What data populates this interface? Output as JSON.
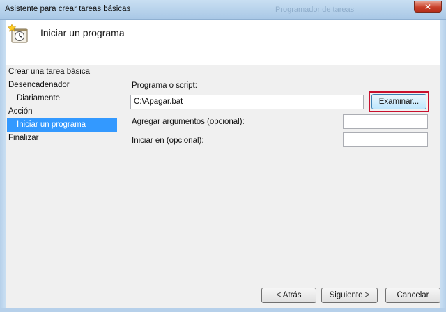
{
  "window": {
    "title": "Asistente para crear tareas básicas",
    "background_title": "Programador de tareas",
    "close_glyph": "✕"
  },
  "header": {
    "title": "Iniciar un programa",
    "icon": "task-clock-icon"
  },
  "sidebar": {
    "items": [
      {
        "label": "Crear una tarea básica",
        "level": 0,
        "active": false
      },
      {
        "label": "Desencadenador",
        "level": 0,
        "active": false
      },
      {
        "label": "Diariamente",
        "level": 1,
        "active": false
      },
      {
        "label": "Acción",
        "level": 0,
        "active": false
      },
      {
        "label": "Iniciar un programa",
        "level": 1,
        "active": true
      },
      {
        "label": "Finalizar",
        "level": 0,
        "active": false
      }
    ]
  },
  "form": {
    "program_label": "Programa o script:",
    "program_value": "C:\\Apagar.bat",
    "browse_label": "Examinar...",
    "args_label": "Agregar argumentos (opcional):",
    "args_value": "",
    "start_in_label": "Iniciar en (opcional):",
    "start_in_value": ""
  },
  "footer": {
    "back_label": "< Atrás",
    "next_label": "Siguiente >",
    "cancel_label": "Cancelar"
  },
  "colors": {
    "selection": "#3399ff",
    "highlight_box": "#c8102e"
  }
}
